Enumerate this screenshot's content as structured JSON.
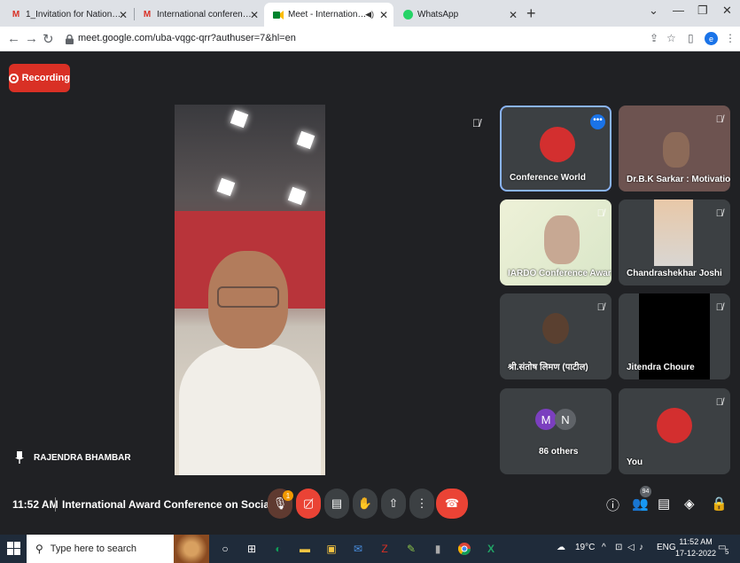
{
  "browser": {
    "tabs": [
      {
        "favicon": "gmail-icon",
        "title": "1_Invitation for National Confere"
      },
      {
        "favicon": "gmail-icon",
        "title": "International conference Mail"
      },
      {
        "favicon": "meet-icon",
        "title": "Meet - International Award C",
        "active": true
      },
      {
        "favicon": "whatsapp-icon",
        "title": "WhatsApp"
      }
    ],
    "url": "meet.google.com/uba-vqgc-qrr?authuser=7&hl=en",
    "profile_initial": "e"
  },
  "meet": {
    "recording_label": "Recording",
    "main_speaker": "RAJENDRA BHAMBAR",
    "tiles": [
      {
        "name": "Conference World"
      },
      {
        "name": "Dr.B.K Sarkar : Motivatio..."
      },
      {
        "name": "IARDO Conference Awar"
      },
      {
        "name": "Chandrashekhar Joshi"
      },
      {
        "name": "श्री.संतोष लिमण (पाटील)"
      },
      {
        "name": "Jitendra Choure"
      },
      {
        "name": "86 others",
        "avatars": [
          "M",
          "N"
        ]
      },
      {
        "name": "You"
      }
    ],
    "time": "11:52 AM",
    "meeting_title": "International Award Conference on Social ...",
    "mic_badge": "1",
    "participant_count": "94"
  },
  "taskbar": {
    "search_placeholder": "Type here to search",
    "weather": "19°C",
    "language": "ENG",
    "clock_time": "11:52 AM",
    "clock_date": "17-12-2022",
    "notification_count": "5"
  },
  "colors": {
    "meet_bg": "#202124",
    "recording_red": "#d93025",
    "end_call_red": "#ea4335",
    "accent_blue": "#1a73e8"
  }
}
